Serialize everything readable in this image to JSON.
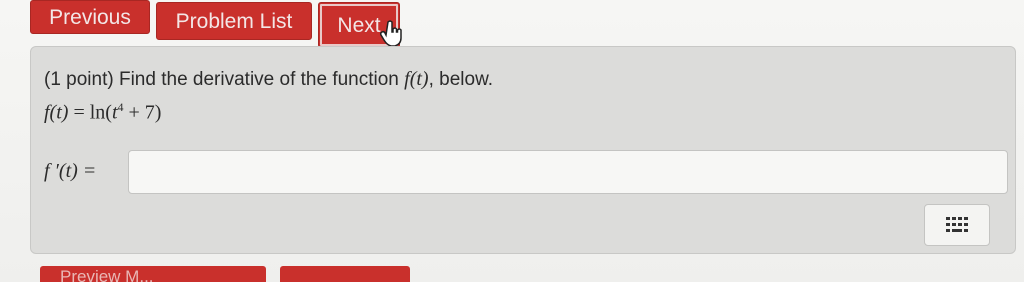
{
  "nav": {
    "previous_label": "Previous",
    "problem_list_label": "Problem List",
    "next_label": "Next"
  },
  "problem": {
    "prefix": "(1 point) Find the derivative of the function ",
    "func": "f(t)",
    "suffix": ", below.",
    "formula_lhs": "f(t)",
    "formula_eq": " = ln(",
    "formula_var": "t",
    "formula_exp": "4",
    "formula_tail": " + 7)"
  },
  "answer": {
    "label": "f ′(t) =",
    "value": ""
  },
  "bottom": {
    "left_label": "Preview M...",
    "right_label": ""
  },
  "colors": {
    "button_red": "#c9302c",
    "panel_gray": "#dcdcda"
  },
  "icons": {
    "cursor": "hand-pointer-icon",
    "toolbar": "equation-editor-icon"
  }
}
